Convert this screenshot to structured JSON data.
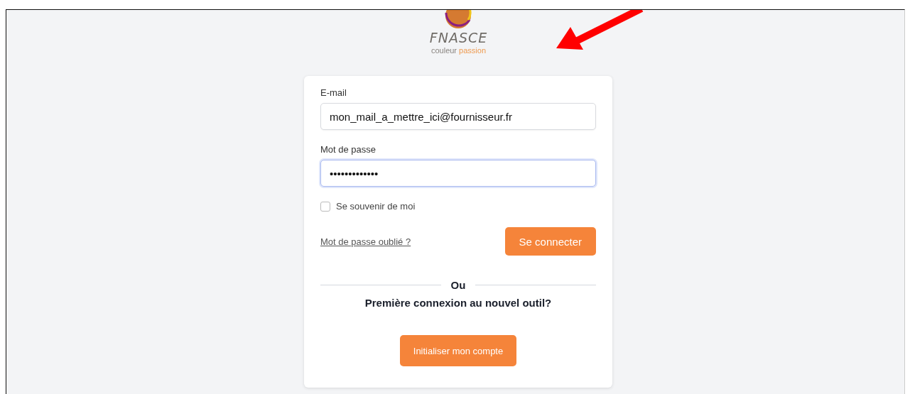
{
  "logo": {
    "name": "FNASCE",
    "tagline_start": "couleur",
    "tagline_end": "passion"
  },
  "form": {
    "email": {
      "label": "E-mail",
      "value": "mon_mail_a_mettre_ici@fournisseur.fr",
      "focused": false
    },
    "password": {
      "label": "Mot de passe",
      "value": "•••••••••••••",
      "focused": true
    },
    "remember": {
      "label": "Se souvenir de moi",
      "checked": false
    },
    "forgot_link": "Mot de passe oublié ?",
    "login_button": "Se connecter",
    "separator": "Ou",
    "first_login_prompt": "Première connexion au nouvel outil?",
    "init_button": "Initialiser mon compte"
  }
}
